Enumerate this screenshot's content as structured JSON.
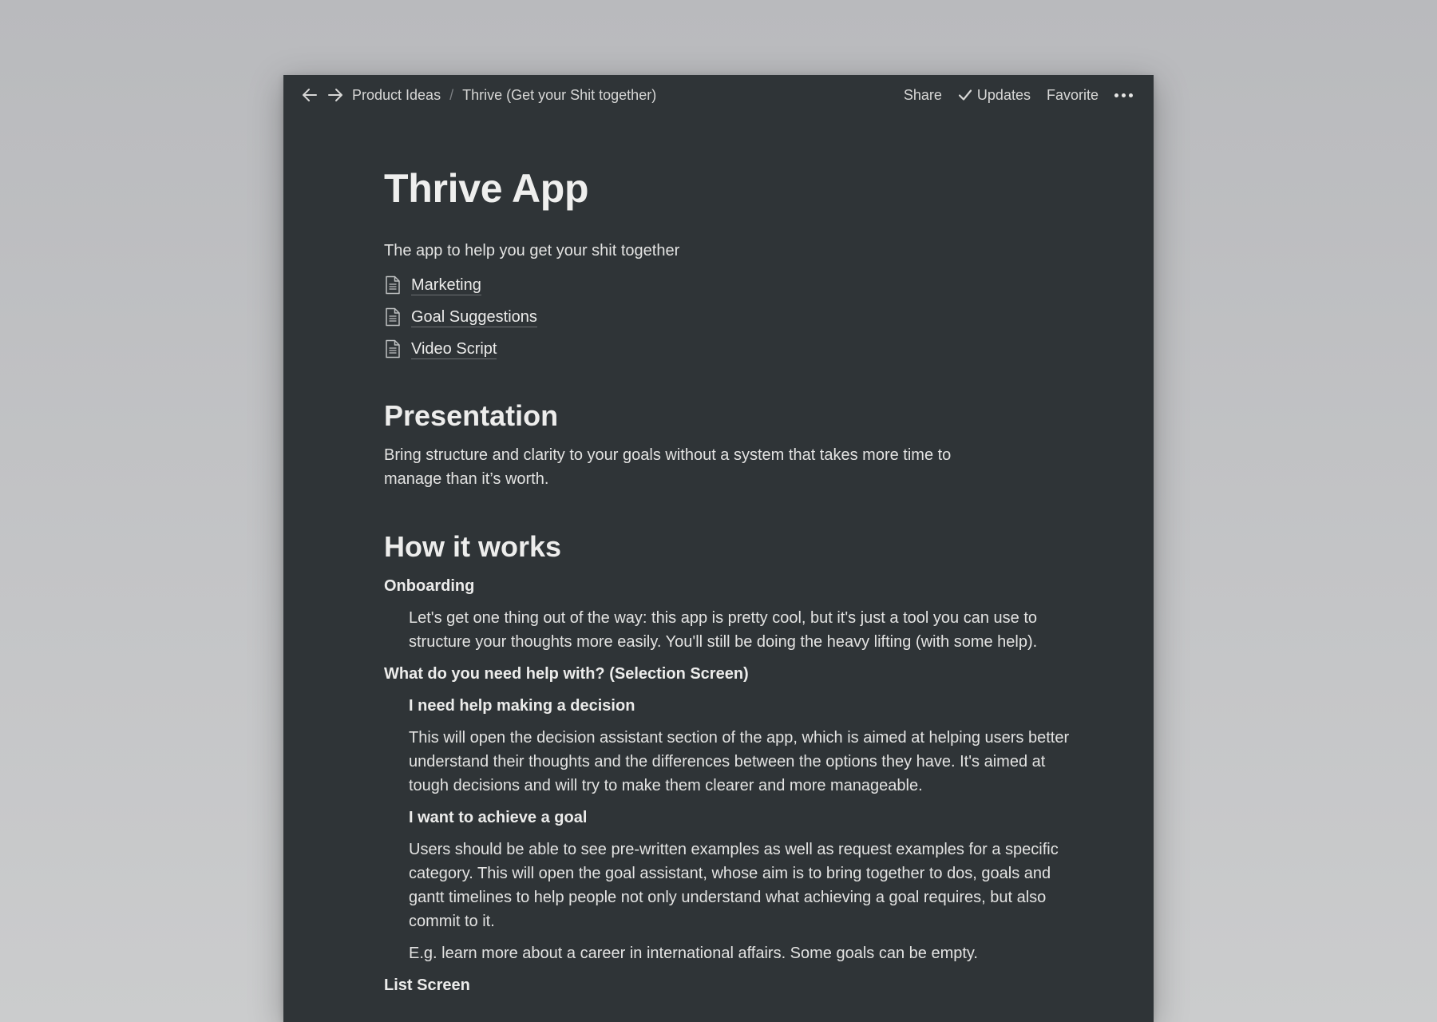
{
  "topbar": {
    "breadcrumb": [
      "Product Ideas",
      "Thrive (Get your Shit together)"
    ],
    "separator": "/",
    "share_label": "Share",
    "updates_label": "Updates",
    "favorite_label": "Favorite"
  },
  "page": {
    "title": "Thrive App",
    "subtitle": "The app to help you get your shit together",
    "links": [
      "Marketing",
      "Goal Suggestions",
      "Video Script"
    ]
  },
  "presentation": {
    "heading": "Presentation",
    "text": "Bring structure and clarity to your goals without a system that takes more time to manage than it’s worth."
  },
  "how_it_works": {
    "heading": "How it works",
    "onboarding_heading": "Onboarding",
    "onboarding_text": "Let's get one thing out of the way: this app is pretty cool, but it's just a tool you can use to structure your thoughts more easily. You'll still be doing the heavy lifting (with some help).",
    "selection_heading": "What do you need help with? (Selection Screen)",
    "decision_heading": "I need help making a decision",
    "decision_text": "This will open the decision assistant section of the app, which is aimed at helping users better understand their thoughts and the differences between the options they have. It's aimed at tough decisions and will try to make them clearer and more manageable.",
    "goal_heading": "I want to achieve a goal",
    "goal_text": "Users should be able to see pre-written examples as well as request examples for a specific category. This will open the goal assistant, whose aim is to bring together to dos, goals and gantt timelines to help people not only understand what achieving a goal requires, but also commit to it.",
    "goal_example": "E.g. learn more about a career in international affairs. Some goals can be empty.",
    "list_heading": "List Screen"
  }
}
